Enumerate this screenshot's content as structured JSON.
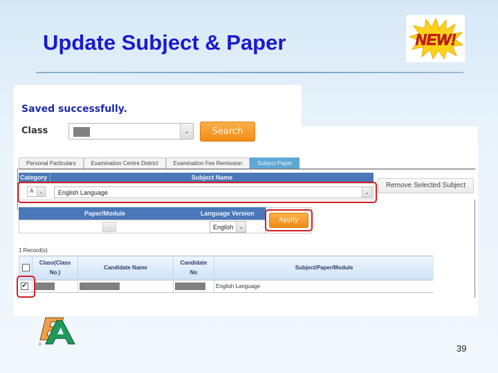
{
  "slide": {
    "title": "Update Subject & Paper",
    "badge_text": "NEW!",
    "page_number": "39"
  },
  "app": {
    "status_message": "Saved successfully.",
    "class_label": "Class",
    "class_value_redacted": true,
    "search_button": "Search",
    "tabs": [
      {
        "label": "Personal Particulars",
        "active": false
      },
      {
        "label": "Examination Centre District",
        "active": false
      },
      {
        "label": "Examination Fee Remission",
        "active": false
      },
      {
        "label": "Subject Paper",
        "active": true
      }
    ],
    "subject": {
      "headers": {
        "category": "Category",
        "subject_name": "Subject Name"
      },
      "category_value": "A",
      "subject_value": "English Language"
    },
    "remove_button": "Remove Selected Subject",
    "paper": {
      "headers": {
        "paper_module": "Paper/Module",
        "language_version": "Language Version"
      },
      "paper_value": "",
      "language_value": "English"
    },
    "apply_button": "Apply",
    "records_count": "1  Record(s)",
    "table": {
      "columns": [
        "",
        "Class(Class No.)",
        "Candidate Name",
        "Candidate No",
        "Subject/Paper/Module"
      ],
      "rows": [
        {
          "checked": true,
          "class_no": "[redacted]",
          "candidate_name": "[redacted]",
          "candidate_no": "[redacted]",
          "subject": "English Language"
        }
      ]
    }
  },
  "colors": {
    "title": "#1a1ad0",
    "highlight": "#d01c25",
    "header_blue": "#4a78b8",
    "orange_button": "#f28c14",
    "active_tab": "#5ea8d6"
  }
}
